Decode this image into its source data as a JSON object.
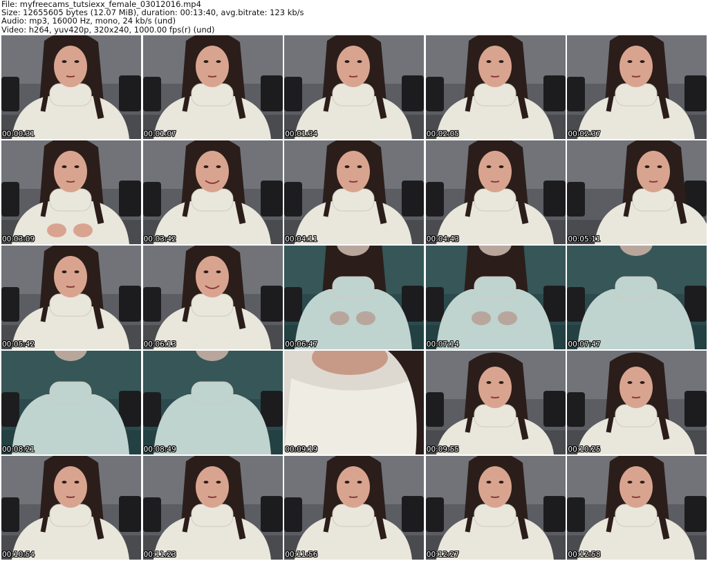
{
  "header": {
    "file": "File: myfreecams_tutsiexx_female_03012016.mp4",
    "size": "Size: 12655605 bytes (12.07 MiB), duration: 00:13:40, avg.bitrate: 123 kb/s",
    "audio": "Audio: mp3, 16000 Hz, mono, 24 kb/s (und)",
    "video": "Video: h264, yuv420p, 320x240, 1000.00 fps(r) (und)"
  },
  "thumbnails": [
    {
      "time": "00:00:31",
      "scene": "face"
    },
    {
      "time": "00:01:07",
      "scene": "face"
    },
    {
      "time": "00:01:34",
      "scene": "face"
    },
    {
      "time": "00:02:05",
      "scene": "face"
    },
    {
      "time": "00:02:37",
      "scene": "face"
    },
    {
      "time": "00:03:09",
      "scene": "hands"
    },
    {
      "time": "00:03:42",
      "scene": "smile"
    },
    {
      "time": "00:04:11",
      "scene": "face"
    },
    {
      "time": "00:04:43",
      "scene": "face"
    },
    {
      "time": "00:05:11",
      "scene": "tilted"
    },
    {
      "time": "00:05:42",
      "scene": "face"
    },
    {
      "time": "00:06:13",
      "scene": "smile"
    },
    {
      "time": "00:06:47",
      "scene": "sweater-hands"
    },
    {
      "time": "00:07:14",
      "scene": "sweater-hands"
    },
    {
      "time": "00:07:47",
      "scene": "sweater"
    },
    {
      "time": "00:08:21",
      "scene": "sweater"
    },
    {
      "time": "00:08:49",
      "scene": "sweater"
    },
    {
      "time": "00:09:19",
      "scene": "closeup"
    },
    {
      "time": "00:09:55",
      "scene": "face-low"
    },
    {
      "time": "00:10:25",
      "scene": "face-low"
    },
    {
      "time": "00:10:54",
      "scene": "face"
    },
    {
      "time": "00:11:23",
      "scene": "face"
    },
    {
      "time": "00:11:56",
      "scene": "face"
    },
    {
      "time": "00:12:27",
      "scene": "face"
    },
    {
      "time": "00:12:58",
      "scene": "face"
    }
  ]
}
